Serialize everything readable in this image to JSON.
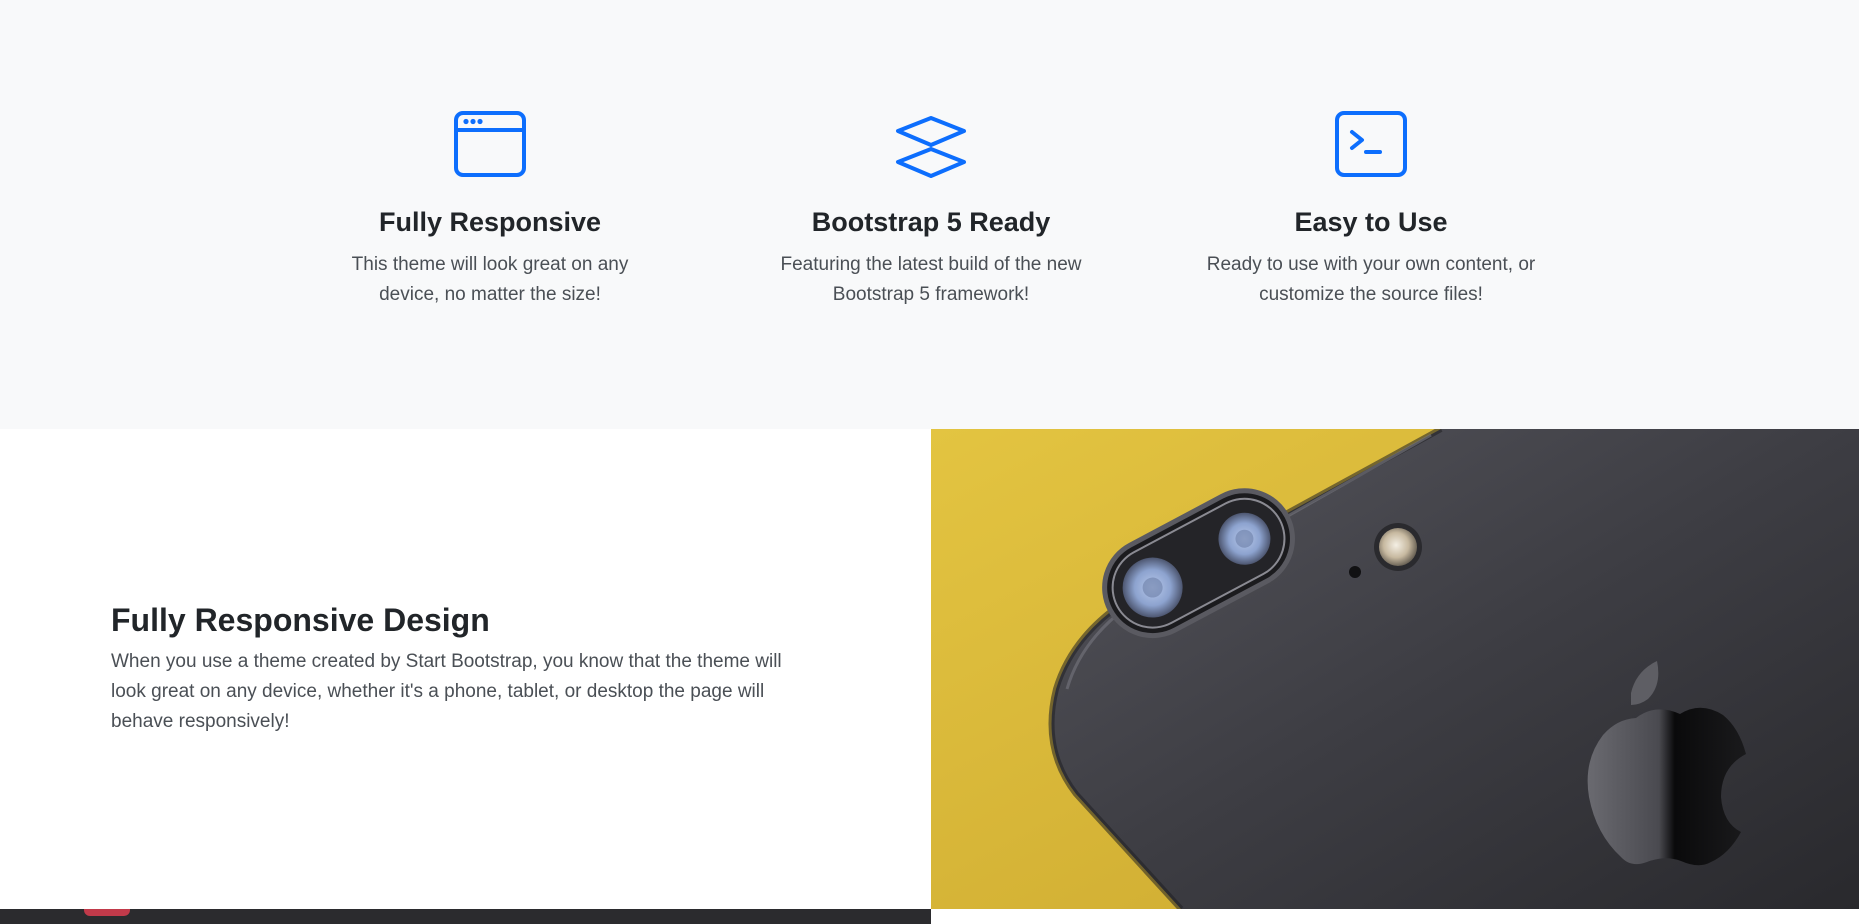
{
  "features": [
    {
      "icon": "window-icon",
      "title": "Fully Responsive",
      "text": "This theme will look great on any device, no matter the size!"
    },
    {
      "icon": "layers-icon",
      "title": "Bootstrap 5 Ready",
      "text": "Featuring the latest build of the new Bootstrap 5 framework!"
    },
    {
      "icon": "terminal-icon",
      "title": "Easy to Use",
      "text": "Ready to use with your own content, or customize the source files!"
    }
  ],
  "showcase": {
    "title": "Fully Responsive Design",
    "text": "When you use a theme created by Start Bootstrap, you know that the theme will look great on any device, whether it's a phone, tablet, or desktop the page will behave responsively!",
    "image": "phone-camera-image"
  },
  "colors": {
    "accent": "#0d6efd",
    "section_bg": "#f8f9fa",
    "heading": "#212529",
    "body_text": "#4a4f55"
  }
}
